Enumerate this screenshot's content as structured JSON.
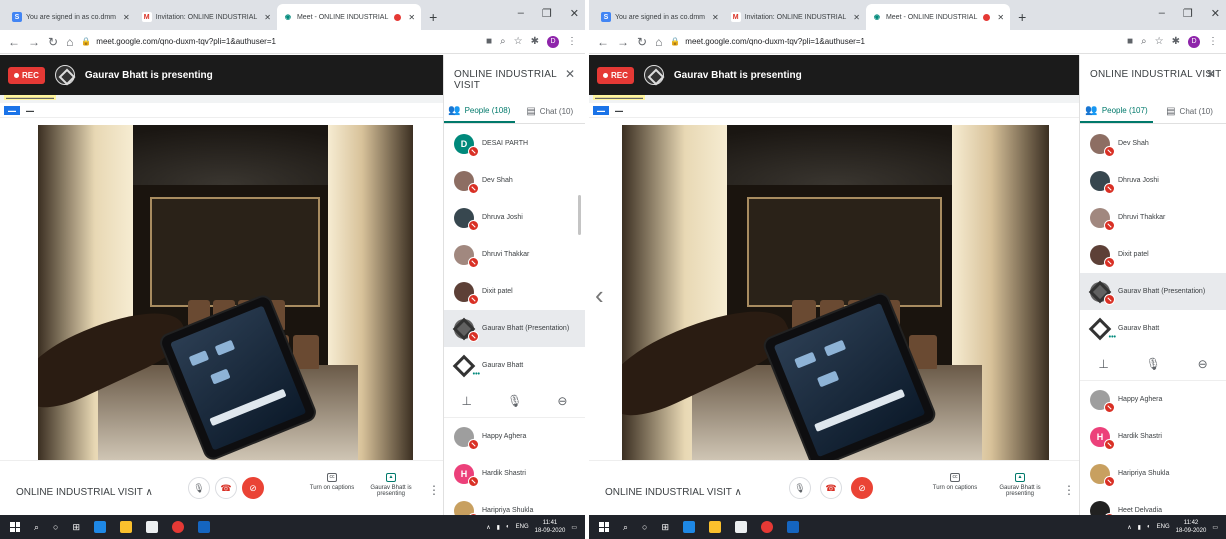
{
  "left": {
    "tabs": [
      {
        "label": "You are signed in as co.dmm",
        "icon": "s-favicon",
        "color": "#4285f4",
        "glyph": "S"
      },
      {
        "label": "Invitation: ONLINE INDUSTRIAL",
        "icon": "gmail-icon",
        "color": "#d93025",
        "glyph": "M"
      },
      {
        "label": "Meet - ONLINE INDUSTRIAL",
        "icon": "meet-icon",
        "color": "#00897b",
        "glyph": "◉"
      }
    ],
    "url": "meet.google.com/qno-duxm-tqv?pli=1&authuser=1",
    "profile_letter": "D",
    "rec_label": "REC",
    "presenting": "Gaurav Bhatt is presenting",
    "panel_title": "ONLINE INDUSTRIAL VISIT",
    "people_tab": "People (108)",
    "chat_tab": "Chat (10)",
    "people_top": [
      {
        "name": "DESAI PARTH",
        "avatar": "letter",
        "letter": "D",
        "color": "#00897b"
      },
      {
        "name": "Dev Shah",
        "avatar": "photo",
        "color": "#8d6e63"
      },
      {
        "name": "Dhruva Joshi",
        "avatar": "photo",
        "color": "#37474f"
      },
      {
        "name": "Dhruvi Thakkar",
        "avatar": "photo",
        "color": "#a1887f"
      },
      {
        "name": "Dixit patel",
        "avatar": "photo",
        "color": "#5d4037"
      },
      {
        "name": "Gaurav Bhatt (Presentation)",
        "avatar": "logo",
        "color": "#616161",
        "highlight": true
      },
      {
        "name": "Gaurav Bhatt",
        "avatar": "logo2",
        "color": "#ffffff"
      }
    ],
    "people_bottom": [
      {
        "name": "Happy Aghera",
        "avatar": "photo",
        "color": "#9e9e9e"
      },
      {
        "name": "Hardik Shastri",
        "avatar": "letter",
        "letter": "H",
        "color": "#ec407a"
      },
      {
        "name": "Haripriya Shukla",
        "avatar": "photo",
        "color": "#c8a060"
      }
    ],
    "meeting_name": "ONLINE INDUSTRIAL VISIT",
    "captions": "Turn on captions",
    "presenting_btn": "Gaurav Bhatt is presenting",
    "clock_time": "11:41",
    "clock_date": "18-09-2020",
    "lang": "ENG"
  },
  "right": {
    "tabs": [
      {
        "label": "You are signed in as co.dmm",
        "icon": "s-favicon",
        "color": "#4285f4",
        "glyph": "S"
      },
      {
        "label": "Invitation: ONLINE INDUSTRIAL",
        "icon": "gmail-icon",
        "color": "#d93025",
        "glyph": "M"
      },
      {
        "label": "Meet - ONLINE INDUSTRIAL",
        "icon": "meet-icon",
        "color": "#00897b",
        "glyph": "◉"
      }
    ],
    "url": "meet.google.com/qno-duxm-tqv?pli=1&authuser=1",
    "profile_letter": "D",
    "rec_label": "REC",
    "presenting": "Gaurav Bhatt is presenting",
    "panel_title": "ONLINE INDUSTRIAL VISIT",
    "people_tab": "People (107)",
    "chat_tab": "Chat (10)",
    "people_top": [
      {
        "name": "Dev Shah",
        "avatar": "photo",
        "color": "#8d6e63"
      },
      {
        "name": "Dhruva Joshi",
        "avatar": "photo",
        "color": "#37474f"
      },
      {
        "name": "Dhruvi Thakkar",
        "avatar": "photo",
        "color": "#a1887f"
      },
      {
        "name": "Dixit patel",
        "avatar": "photo",
        "color": "#5d4037"
      },
      {
        "name": "Gaurav Bhatt (Presentation)",
        "avatar": "logo",
        "color": "#616161",
        "highlight": true
      },
      {
        "name": "Gaurav Bhatt",
        "avatar": "logo2",
        "color": "#ffffff"
      }
    ],
    "people_bottom": [
      {
        "name": "Happy Aghera",
        "avatar": "photo",
        "color": "#9e9e9e"
      },
      {
        "name": "Hardik Shastri",
        "avatar": "letter",
        "letter": "H",
        "color": "#ec407a"
      },
      {
        "name": "Haripriya Shukla",
        "avatar": "photo",
        "color": "#c8a060"
      },
      {
        "name": "Heet Delvadia",
        "avatar": "photo",
        "color": "#212121"
      }
    ],
    "meeting_name": "ONLINE INDUSTRIAL VISIT",
    "captions": "Turn on captions",
    "presenting_btn": "Gaurav Bhatt is presenting",
    "clock_time": "11:42",
    "clock_date": "18-09-2020",
    "lang": "ENG"
  },
  "colors": {
    "accent": "#00796b",
    "rec": "#e53935",
    "end_call": "#ea4335",
    "taskbar": "#20232a"
  }
}
